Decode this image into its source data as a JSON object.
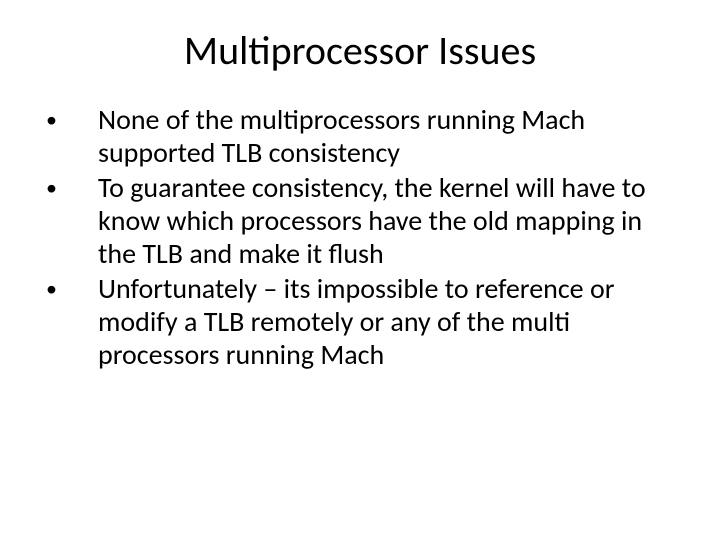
{
  "slide": {
    "title": "Multiprocessor Issues",
    "bullets": [
      "None of the multiprocessors running Mach supported TLB consistency",
      "To guarantee consistency, the kernel will have to know which processors have the old mapping in the TLB and make it flush",
      "Unfortunately – its impossible to reference or modify a TLB remotely or any of the multi processors running Mach"
    ]
  }
}
